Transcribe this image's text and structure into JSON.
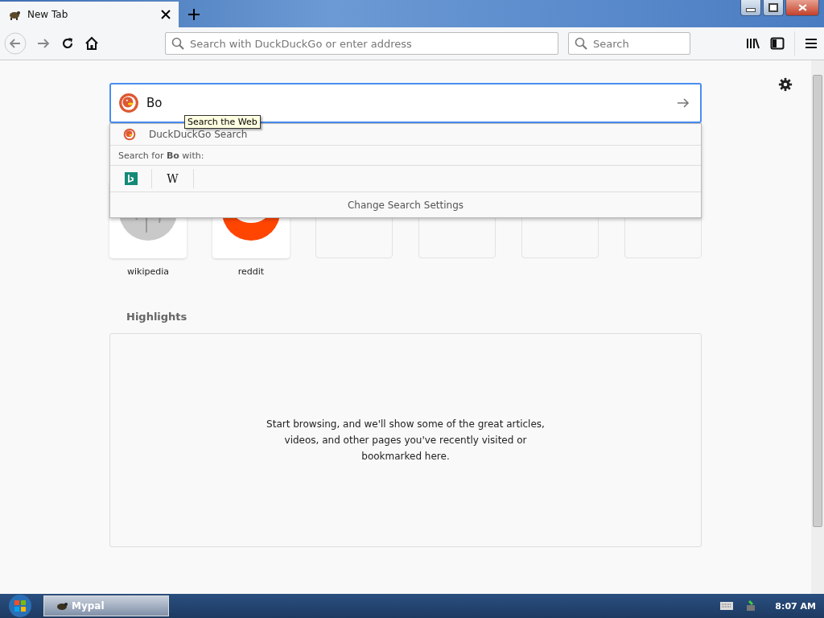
{
  "tab": {
    "title": "New Tab"
  },
  "toolbar": {
    "address_placeholder": "Search with DuckDuckGo or enter address",
    "search_placeholder": "Search"
  },
  "search": {
    "value": "Bo",
    "tooltip": "Search the Web"
  },
  "dropdown": {
    "suggestion": "DuckDuckGo Search",
    "search_for": "Search for **Bo** with:",
    "engines": [
      {
        "kind": "bing"
      },
      {
        "kind": "wikipedia",
        "glyph": "W"
      }
    ],
    "settings": "Change Search Settings"
  },
  "top_sites": [
    {
      "kind": "wikipedia",
      "label": "wikipedia"
    },
    {
      "kind": "reddit",
      "label": "reddit"
    },
    {
      "kind": "empty"
    },
    {
      "kind": "empty"
    },
    {
      "kind": "empty"
    },
    {
      "kind": "empty"
    }
  ],
  "highlights": {
    "title": "Highlights",
    "message": "Start browsing, and we'll show some of the great articles, videos, and other pages you've recently visited or bookmarked here."
  },
  "taskbar": {
    "app": "Mypal",
    "clock": "8:07 AM"
  }
}
